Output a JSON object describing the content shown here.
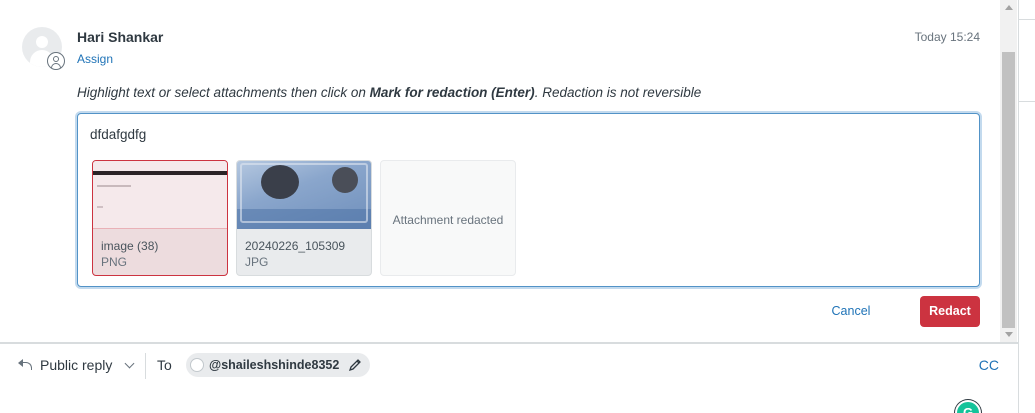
{
  "comment": {
    "author": "Hari Shankar",
    "assign_label": "Assign",
    "timestamp": "Today 15:24"
  },
  "redaction": {
    "instruction_before": "Highlight text or select attachments then click on ",
    "instruction_bold": "Mark for redaction (Enter)",
    "instruction_after": ". Redaction is not reversible",
    "body_text": "dfdafgdfg",
    "attachments": [
      {
        "name": "image (38)",
        "type": "PNG",
        "selected": true
      },
      {
        "name": "20240226_105309",
        "type": "JPG",
        "selected": false
      },
      {
        "redacted_label": "Attachment redacted"
      }
    ],
    "cancel_label": "Cancel",
    "redact_label": "Redact"
  },
  "reply": {
    "type_label": "Public reply",
    "to_label": "To",
    "recipient": "@shaileshshinde8352",
    "cc_label": "CC"
  },
  "colors": {
    "danger": "#cc3340",
    "link": "#1f73b7",
    "focus_border": "#5293c7"
  },
  "icons": [
    "user-avatar-icon",
    "user-badge-icon",
    "reply-arrow-icon",
    "chevron-down-icon",
    "pencil-icon",
    "grammarly-icon"
  ]
}
